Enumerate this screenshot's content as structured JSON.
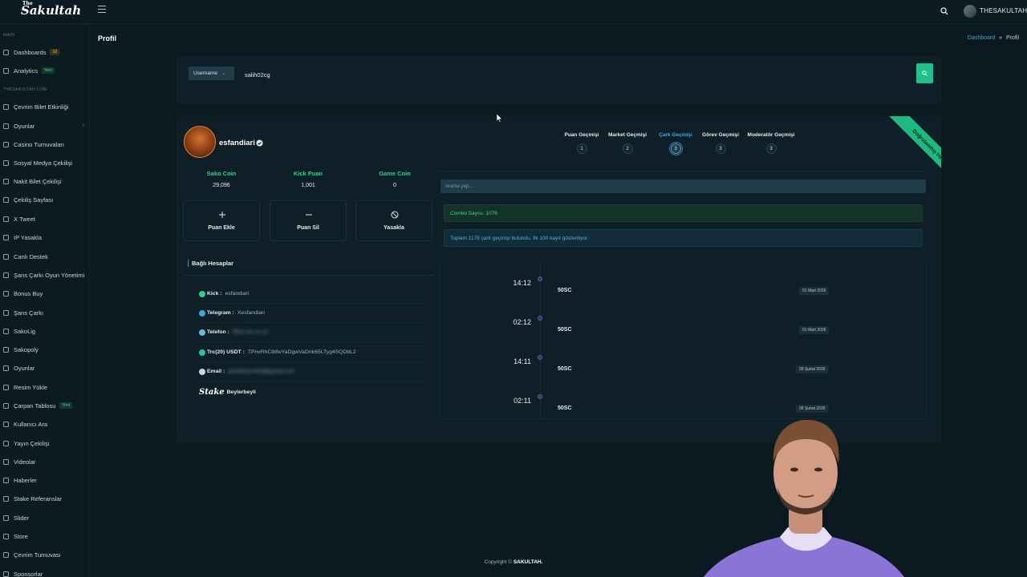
{
  "app": {
    "logo_small": "The",
    "logo": "Sakultah",
    "username": "THESAKULTAH"
  },
  "sidebar": {
    "section_main": "MAIN",
    "section_site": "THESAKULTAH.COM",
    "main_items": [
      {
        "label": "Dashboards",
        "badge": "12",
        "badge_color": "yellow"
      },
      {
        "label": "Analytics",
        "badge": "Yeni",
        "badge_color": "green"
      }
    ],
    "items": [
      {
        "label": "Çevrim Bilet Etkinliği"
      },
      {
        "label": "Oyunlar",
        "has_children": true
      },
      {
        "label": "Casino Turnuvaları"
      },
      {
        "label": "Sosyal Medya Çekilişi"
      },
      {
        "label": "Nakit Bilet Çekilişi"
      },
      {
        "label": "Çekiliş Sayfası"
      },
      {
        "label": "X Tweet"
      },
      {
        "label": "IP Yasakla"
      },
      {
        "label": "Canlı Destek"
      },
      {
        "label": "Şans Çarkı Oyun Yönetimi"
      },
      {
        "label": "Bonus Buy"
      },
      {
        "label": "Şans Çarkı"
      },
      {
        "label": "SakoLig"
      },
      {
        "label": "Sakopoly"
      },
      {
        "label": "Oyunlar"
      },
      {
        "label": "Resim Yükle"
      },
      {
        "label": "Çarpan Tablosu",
        "badge": "Yeni"
      },
      {
        "label": "Kullanıcı Ara"
      },
      {
        "label": "Yayın Çekilişi"
      },
      {
        "label": "Videolar"
      },
      {
        "label": "Haberler"
      },
      {
        "label": "Stake Referanslar"
      },
      {
        "label": "Slider"
      },
      {
        "label": "Store"
      },
      {
        "label": "Çevrim Turnuvası"
      },
      {
        "label": "Sponsorlar"
      }
    ]
  },
  "page": {
    "title": "Profil",
    "breadcrumb_home": "Dashboard",
    "breadcrumb_sep": "»",
    "breadcrumb_current": "Profil"
  },
  "search": {
    "type": "Username",
    "value": "salih02cg"
  },
  "profile": {
    "name": "esfandiari",
    "ribbon": "Doğrulanmış Hesap",
    "stats": [
      {
        "label": "Sako Coin",
        "value": "29,096"
      },
      {
        "label": "Kick Puan",
        "value": "1,001"
      },
      {
        "label": "Game Coin",
        "value": "0"
      }
    ],
    "actions": [
      {
        "label": "Puan Ekle",
        "icon": "plus-icon"
      },
      {
        "label": "Puan Sil",
        "icon": "minus-icon"
      },
      {
        "label": "Yasakla",
        "icon": "ban-icon"
      }
    ],
    "linked_title": "Bağlı Hesaplar",
    "linked": {
      "kick": {
        "key": "Kick :",
        "value": "esfandiari"
      },
      "telegram": {
        "key": "Telegram :",
        "value": "Xesfandiari"
      },
      "phone": {
        "key": "Telefon :",
        "value": "05xx xxx xx xx"
      },
      "trc": {
        "key": "Trc(20) USDT :",
        "value": "TPnvRhC8tfwYaDgwVaDnk65LTyg4SQDbL2"
      },
      "email": {
        "key": "Email :",
        "value": "pxxxfdxxxx018@gmail.com"
      },
      "stake": {
        "logo": "Stake",
        "value": "Beylerbeyli"
      }
    }
  },
  "history": {
    "tabs": [
      {
        "label": "Puan Geçmişi",
        "count": "1"
      },
      {
        "label": "Market Geçmişi",
        "count": "2"
      },
      {
        "label": "Çark Geçmişi",
        "count": "3",
        "active": true
      },
      {
        "label": "Görev Geçmişi",
        "count": "3"
      },
      {
        "label": "Moderatör Geçmişi",
        "count": "3"
      }
    ],
    "search_placeholder": "Arama yap...",
    "combo": "Combo Sayısı: 1076",
    "info": "Toplam 1178 çark geçmişi bulundu. İlk 100 kayıt gösteriliyor.",
    "entries": [
      {
        "time": "14:12",
        "value": "50SC",
        "date": "01 Mart 2026"
      },
      {
        "time": "02:12",
        "value": "50SC",
        "date": "01 Mart 2026"
      },
      {
        "time": "14:11",
        "value": "50SC",
        "date": "28 Şubat 2026"
      },
      {
        "time": "02:11",
        "value": "50SC",
        "date": "28 Şubat 2026"
      }
    ]
  },
  "footer": {
    "prefix": "Copyright ©",
    "brand": "SAKULTAH."
  },
  "colors": {
    "accent_green": "#22c08a",
    "accent_blue": "#3fa9d6",
    "bg": "#0b1920",
    "card": "#0e1f27"
  }
}
